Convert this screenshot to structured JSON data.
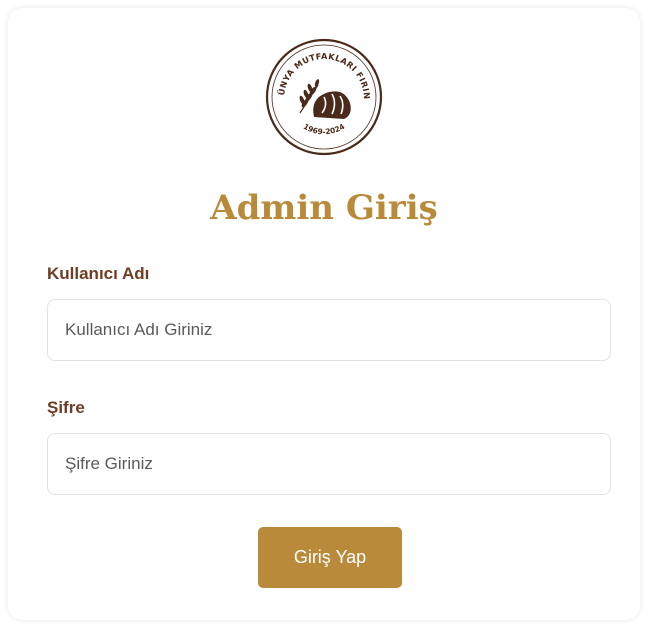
{
  "colors": {
    "accent": "#b98a3a",
    "label": "#6f3d24",
    "logo_dark": "#4a2a1a",
    "button_text": "#ffffff"
  },
  "logo": {
    "icon": "bakery-logo",
    "arc_text": "DÜNYA MUTFAKLARI FIRINI",
    "years": "1969-2024"
  },
  "login": {
    "title": "Admin Giriş",
    "username_label": "Kullanıcı Adı",
    "username_placeholder": "Kullanıcı Adı Giriniz",
    "username_value": "",
    "password_label": "Şifre",
    "password_placeholder": "Şifre Giriniz",
    "password_value": "",
    "submit_label": "Giriş Yap"
  }
}
